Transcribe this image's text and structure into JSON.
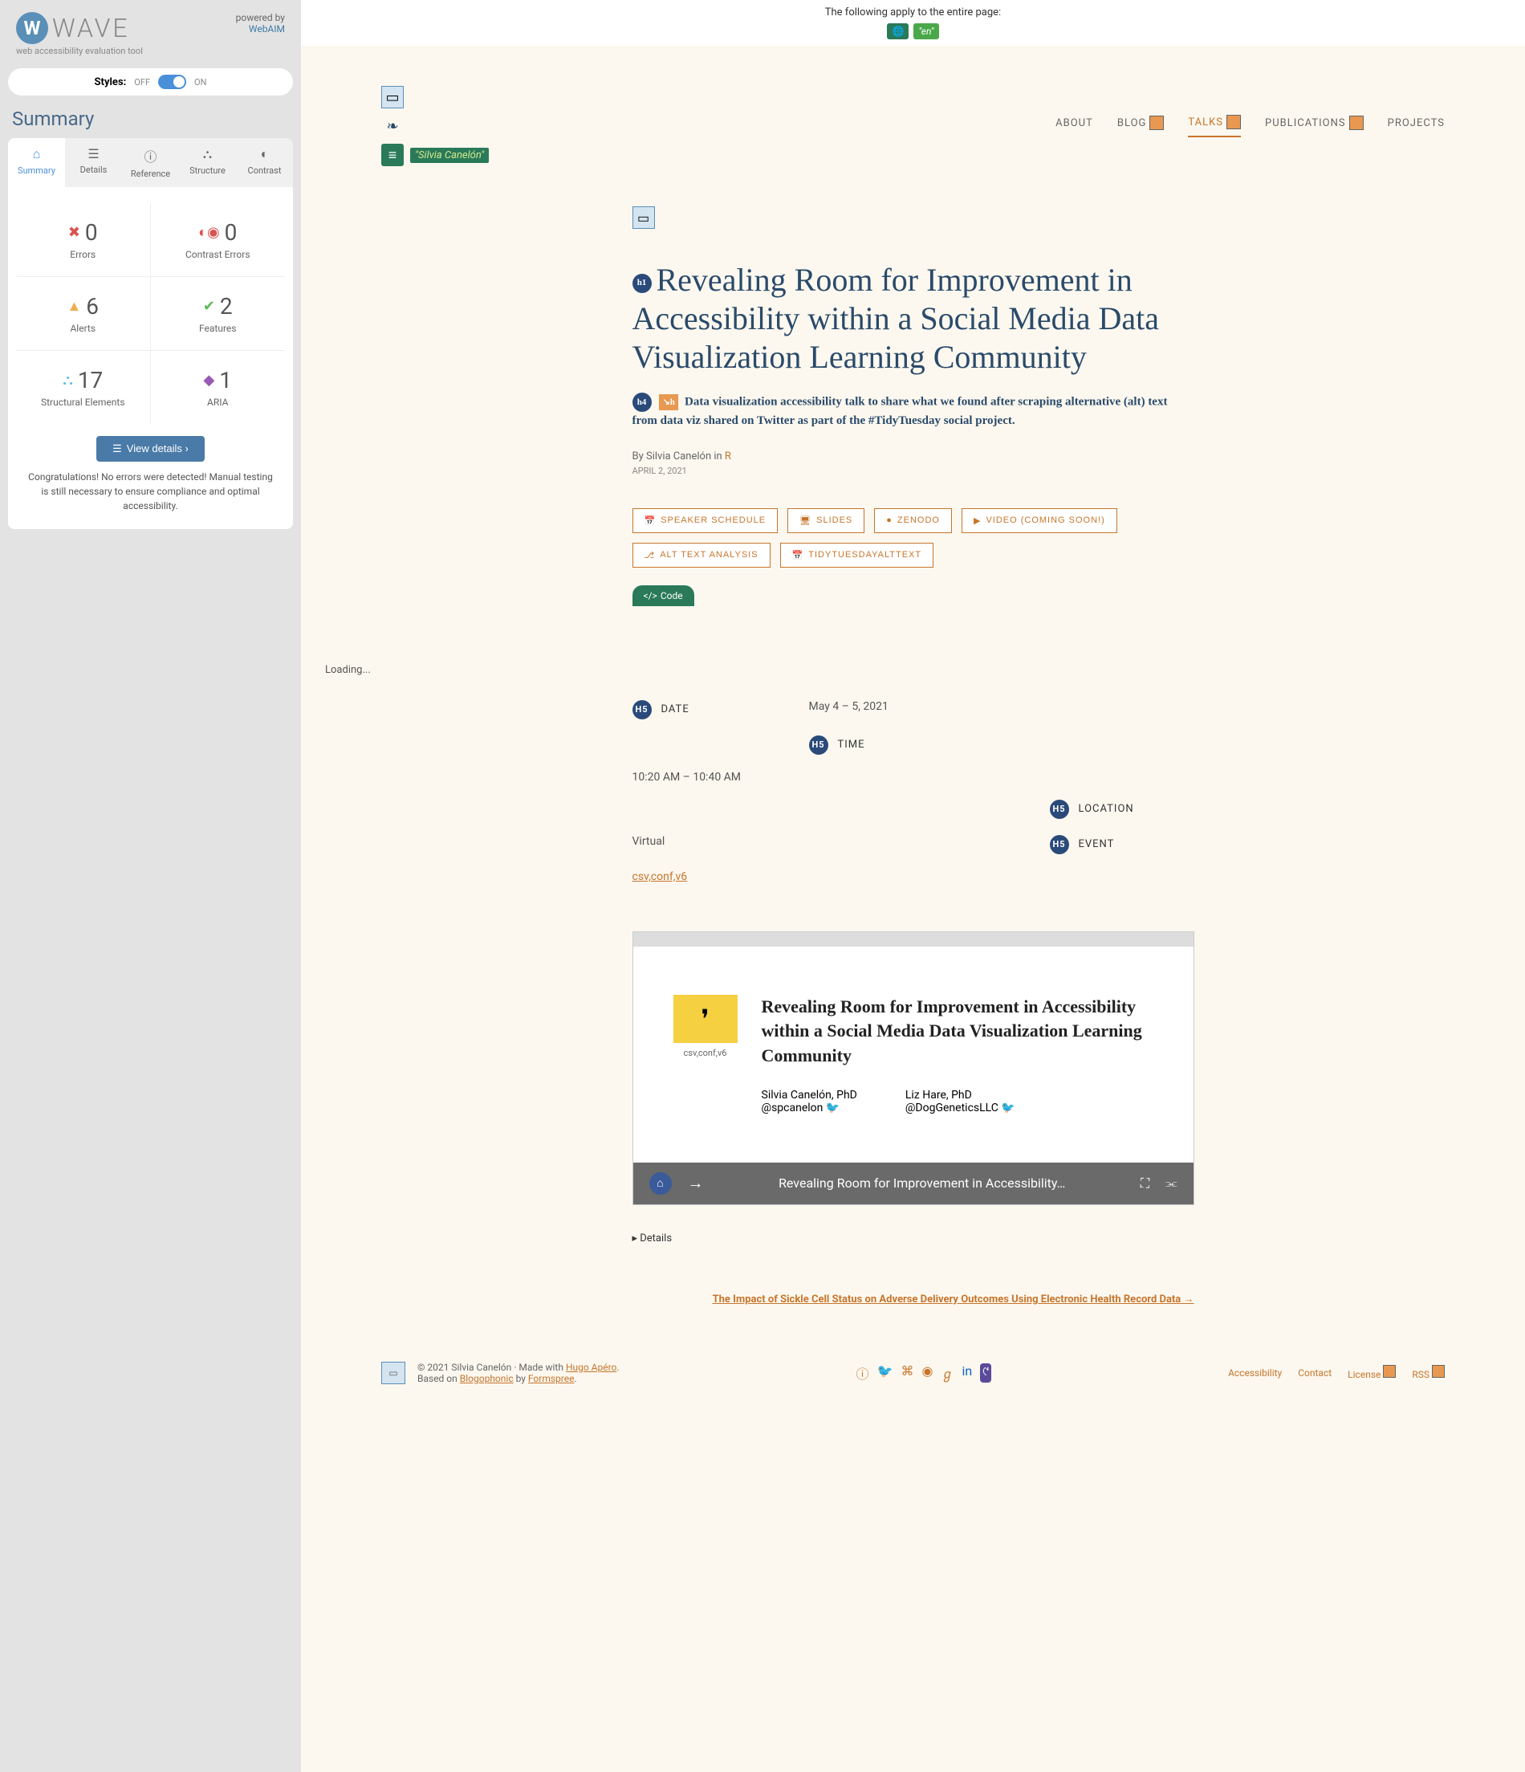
{
  "wave": {
    "title": "WAVE",
    "subtitle": "web accessibility evaluation tool",
    "powered_label": "powered by",
    "powered_link": "WebAIM"
  },
  "styles": {
    "label": "Styles:",
    "off": "OFF",
    "on": "ON"
  },
  "summary_title": "Summary",
  "tabs": [
    "Summary",
    "Details",
    "Reference",
    "Structure",
    "Contrast"
  ],
  "stats": [
    {
      "icon": "✖",
      "cls": "ic-error",
      "value": "0",
      "label": "Errors"
    },
    {
      "icon": "◐◉",
      "cls": "ic-contrast",
      "value": "0",
      "label": "Contrast Errors"
    },
    {
      "icon": "▲",
      "cls": "ic-alert",
      "value": "6",
      "label": "Alerts"
    },
    {
      "icon": "✔",
      "cls": "ic-feature",
      "value": "2",
      "label": "Features"
    },
    {
      "icon": "⛬",
      "cls": "ic-struct",
      "value": "17",
      "label": "Structural Elements"
    },
    {
      "icon": "◆",
      "cls": "ic-aria",
      "value": "1",
      "label": "ARIA"
    }
  ],
  "view_details": "View details ›",
  "congrats": "Congratulations! No errors were detected! Manual testing is still necessary to ensure compliance and optimal accessibility.",
  "top_strip": "The following apply to the entire page:",
  "lang_en": "\"en\"",
  "silvia_tag": "\"Silvia Canelón\"",
  "nav": [
    {
      "label": "ABOUT",
      "marker": false
    },
    {
      "label": "BLOG",
      "marker": true
    },
    {
      "label": "TALKS",
      "marker": true,
      "active": true
    },
    {
      "label": "PUBLICATIONS",
      "marker": true
    },
    {
      "label": "PROJECTS",
      "marker": false
    }
  ],
  "h1": "Revealing Room for Improvement in Accessibility within a Social Media Data Visualization Learning Community",
  "subtitle": "Data visualization accessibility talk to share what we found after scraping alternative (alt) text from data viz shared on Twitter as part of the #TidyTuesday social project.",
  "byline_prefix": "By Silvia Canelón in ",
  "byline_link": "R",
  "date_small": "APRIL 2, 2021",
  "buttons": [
    "SPEAKER SCHEDULE",
    "SLIDES",
    "ZENODO",
    "VIDEO (COMING SOON!)",
    "ALT TEXT ANALYSIS",
    "TIDYTUESDAYALTTEXT"
  ],
  "code_label": "Code",
  "loading": "Loading...",
  "details": {
    "date_label": "DATE",
    "date_value": "May 4 – 5, 2021",
    "time_label": "TIME",
    "time_value": "10:20 AM – 10:40 AM",
    "location_label": "LOCATION",
    "location_value": "Virtual",
    "event_label": "EVENT",
    "event_value": "csv,conf,v6"
  },
  "embed": {
    "icon_label": "csv,conf,v6",
    "title": "Revealing Room for Improvement in Accessibility within a Social Media Data Visualization Learning Community",
    "author1_name": "Silvia Canelón, PhD",
    "author1_handle": "@spcanelon",
    "author2_name": "Liz Hare, PhD",
    "author2_handle": "@DogGeneticsLLC",
    "bottom_title": "Revealing Room for Improvement in Accessibility…"
  },
  "details_toggle": "▸  Details",
  "next_link": "The Impact of Sickle Cell Status on Adverse Delivery Outcomes Using Electronic Health Record Data →",
  "footer": {
    "copyright": "© 2021 Silvia Canelón",
    "dot": " · ",
    "made": "Made with ",
    "hugo": "Hugo Apéro",
    "based": "Based on ",
    "blogo": "Blogophonic",
    "by": " by ",
    "form": "Formspree",
    "links": [
      "Accessibility",
      "Contact",
      "License",
      "RSS"
    ]
  }
}
